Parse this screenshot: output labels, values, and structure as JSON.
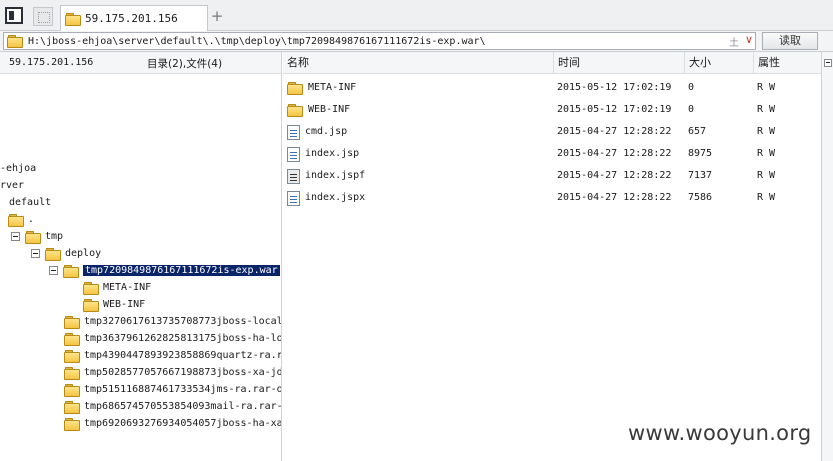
{
  "tab": {
    "title": "59.175.201.156"
  },
  "address": {
    "path": "H:\\jboss-ehjoa\\server\\default\\.\\tmp\\deploy\\tmp7209849876167111672is-exp.war\\",
    "pin_glyph": "土",
    "dropdown_glyph": "∨",
    "read_button": "读取"
  },
  "left_panel": {
    "host": "59.175.201.156",
    "counts": "目录(2),文件(4)",
    "tree": [
      {
        "label": "-ehjoa"
      },
      {
        "label": "rver"
      },
      {
        "label": "default"
      },
      {
        "label": "."
      },
      {
        "label": "tmp"
      },
      {
        "label": "deploy"
      },
      {
        "label": "tmp7209849876167111672is-exp.war"
      },
      {
        "label": "META-INF"
      },
      {
        "label": "WEB-INF"
      },
      {
        "label": "tmp3270617613735708773jboss-local"
      },
      {
        "label": "tmp3637961262825813175jboss-ha-lo"
      },
      {
        "label": "tmp4390447893923858869quartz-ra.r"
      },
      {
        "label": "tmp5028577057667198873jboss-xa-jd"
      },
      {
        "label": "tmp5151168874617335​34jms-ra.rar-o"
      },
      {
        "label": "tmp6865745705538540​93mail-ra.rar-"
      },
      {
        "label": "tmp6920693276934054057jboss-ha-xa"
      }
    ]
  },
  "file_list": {
    "columns": {
      "name": "名称",
      "time": "时间",
      "size": "大小",
      "attr": "属性"
    },
    "rows": [
      {
        "name": "META-INF",
        "time": "2015-05-12 17:02:19",
        "size": "0",
        "attr": "R W"
      },
      {
        "name": "WEB-INF",
        "time": "2015-05-12 17:02:19",
        "size": "0",
        "attr": "R W"
      },
      {
        "name": "cmd.jsp",
        "time": "2015-04-27 12:28:22",
        "size": "657",
        "attr": "R W"
      },
      {
        "name": "index.jsp",
        "time": "2015-04-27 12:28:22",
        "size": "8975",
        "attr": "R W"
      },
      {
        "name": "index.jspf",
        "time": "2015-04-27 12:28:22",
        "size": "7137",
        "attr": "R W"
      },
      {
        "name": "index.jspx",
        "time": "2015-04-27 12:28:22",
        "size": "7586",
        "attr": "R W"
      }
    ]
  },
  "watermark": "www.wooyun.org",
  "colors": {
    "selection": "#0a246a",
    "folder": "#f4c443"
  }
}
